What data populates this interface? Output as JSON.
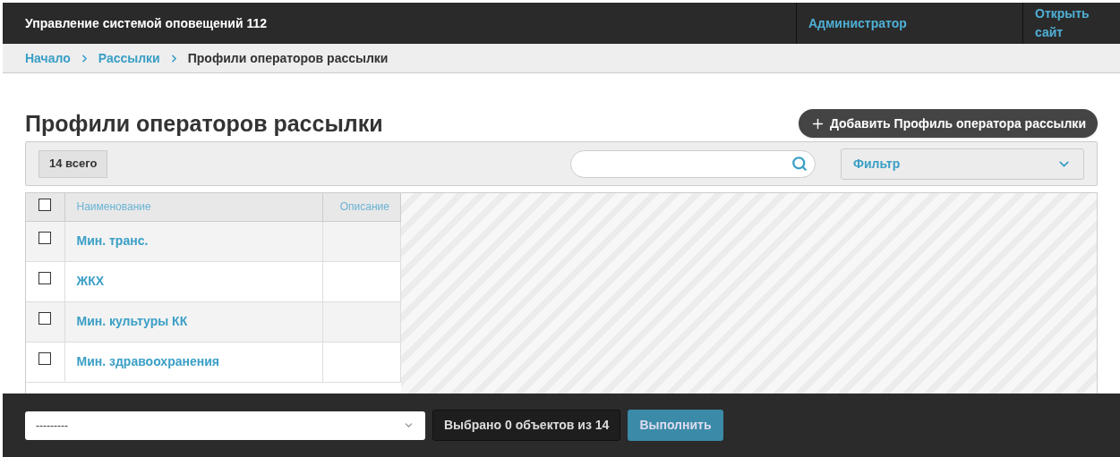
{
  "header": {
    "title": "Управление системой оповещений 112",
    "links": [
      "Администратор",
      "Открыть сайт"
    ]
  },
  "breadcrumbs": {
    "items": [
      "Начало",
      "Рассылки"
    ],
    "current": "Профили операторов рассылки"
  },
  "page_title": "Профили операторов рассылки",
  "add_button": "Добавить Профиль оператора рассылки",
  "toolbar": {
    "count": "14 всего",
    "filter": "Фильтр"
  },
  "table": {
    "select_all_checked": false,
    "columns": [
      "Наименование",
      "Описание"
    ],
    "rows": [
      {
        "name": "Мин. транс.",
        "checked": false
      },
      {
        "name": "ЖКХ",
        "checked": false
      },
      {
        "name": "Мин. культуры КК",
        "checked": false
      },
      {
        "name": "Мин. здравоохранения",
        "checked": false
      }
    ]
  },
  "action_bar": {
    "action": "---------",
    "selection": "Выбрано 0 объектов из 14",
    "run": "Выполнить"
  }
}
